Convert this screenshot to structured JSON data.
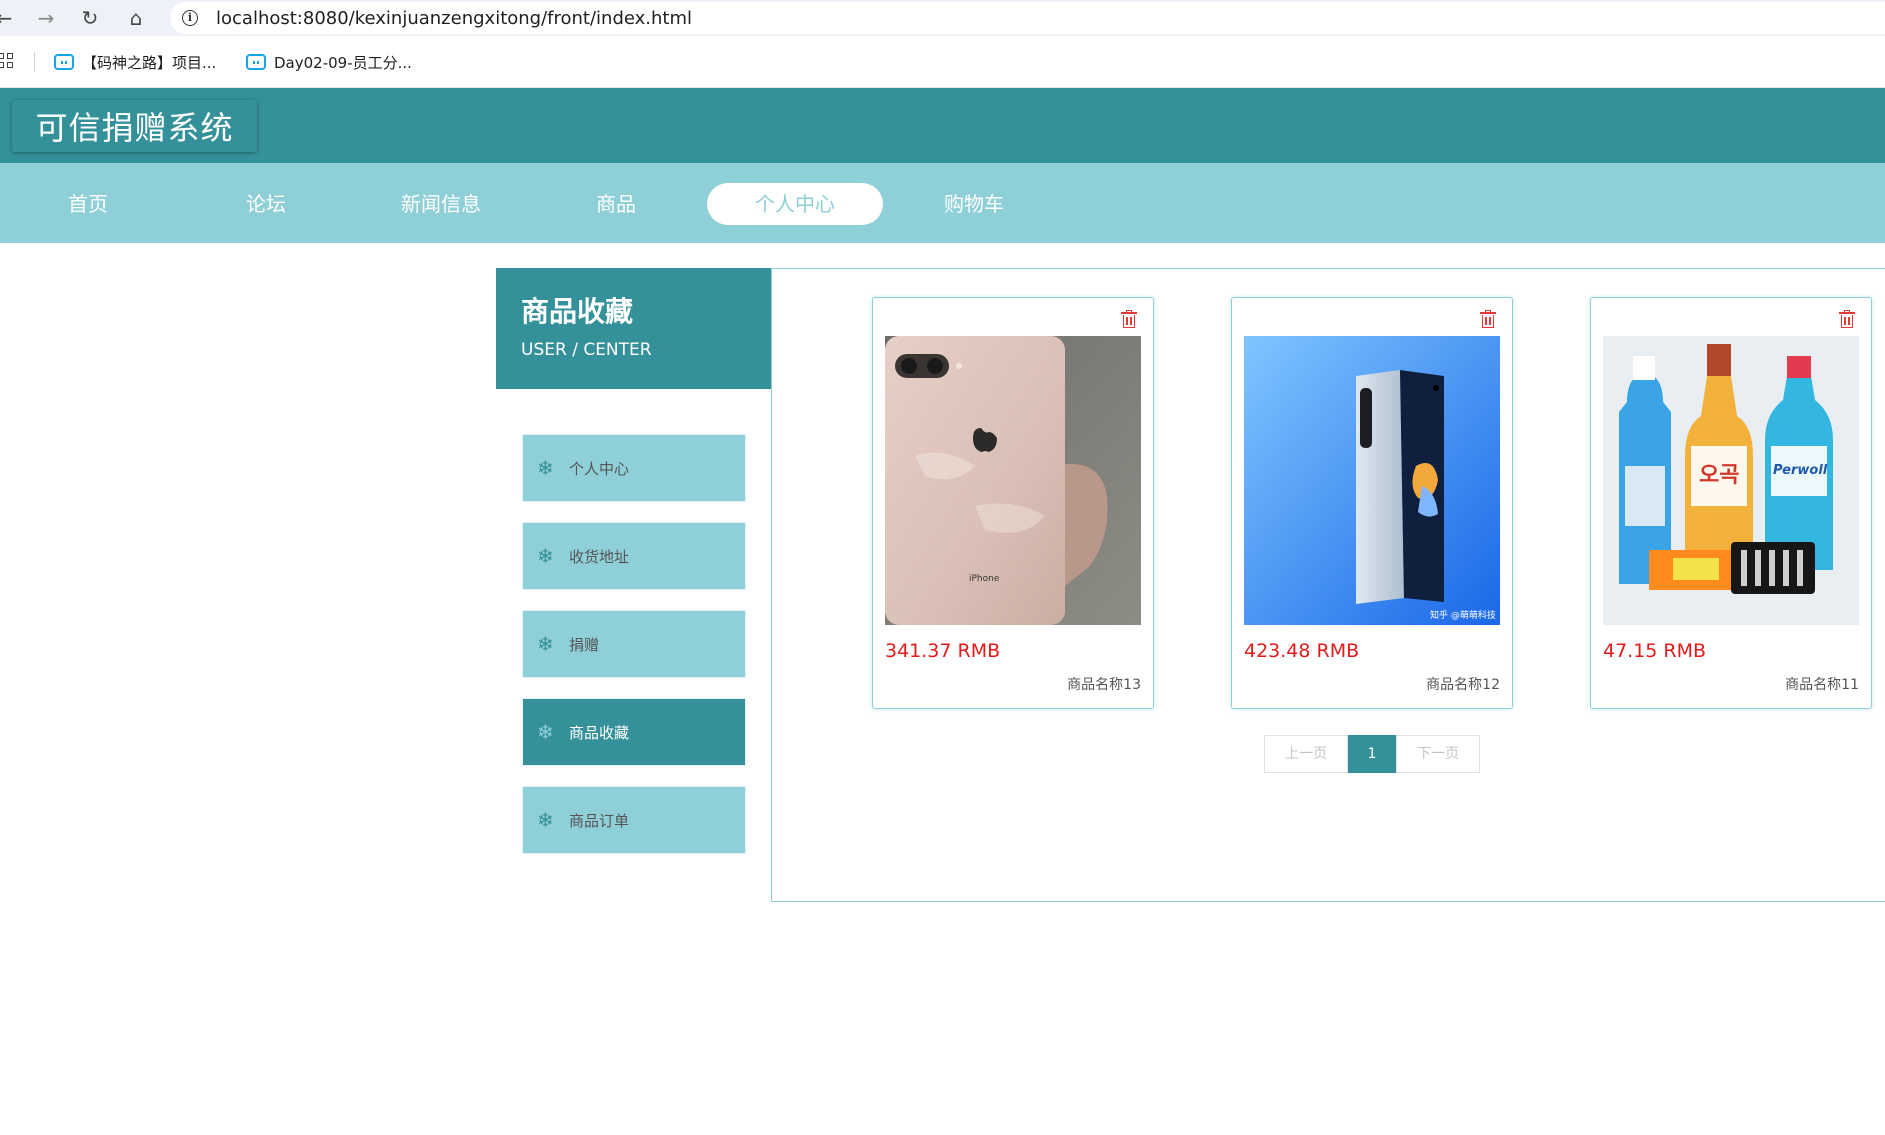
{
  "browser": {
    "url": "localhost:8080/kexinjuanzengxitong/front/index.html",
    "bookmarks": [
      "【码神之路】项目...",
      "Day02-09-员工分..."
    ]
  },
  "site": {
    "logo": "可信捐赠系统"
  },
  "nav": {
    "items": [
      "首页",
      "论坛",
      "新闻信息",
      "商品",
      "个人中心",
      "购物车"
    ],
    "active": "个人中心"
  },
  "sidebar": {
    "title": "商品收藏",
    "subtitle": "USER / CENTER",
    "items": [
      "个人中心",
      "收货地址",
      "捐赠",
      "商品收藏",
      "商品订单"
    ],
    "active": "商品收藏"
  },
  "products": [
    {
      "price": "341.37 RMB",
      "name": "商品名称13",
      "image": "pink-iphone-photo"
    },
    {
      "price": "423.48 RMB",
      "name": "商品名称12",
      "image": "blue-foldable-phone-photo",
      "image_caption": "知乎 @萌萌科技"
    },
    {
      "price": "47.15 RMB",
      "name": "商品名称11",
      "image": "detergent-bottles-photo"
    }
  ],
  "pagination": {
    "prev": "上一页",
    "current": "1",
    "next": "下一页"
  },
  "colors": {
    "primary": "#34919a",
    "light": "#8fd0d8",
    "price": "#e31b1b"
  }
}
